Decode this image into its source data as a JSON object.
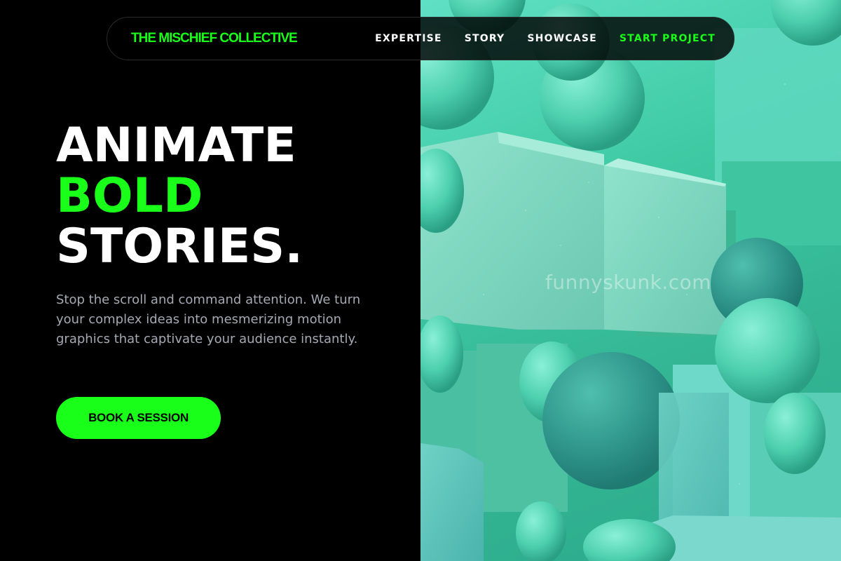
{
  "brand": {
    "name": "THE MISCHIEF COLLECTIVE"
  },
  "nav": {
    "items": [
      {
        "label": "EXPERTISE"
      },
      {
        "label": "STORY"
      },
      {
        "label": "SHOWCASE"
      },
      {
        "label": "START PROJECT"
      }
    ]
  },
  "hero": {
    "line1": "ANIMATE",
    "line2": "BOLD",
    "line3": "STORIES.",
    "description": "Stop the scroll and command attention. We turn your complex ideas into mesmerizing motion graphics that captivate your audience instantly.",
    "cta_label": "BOOK A SESSION"
  },
  "visual": {
    "watermark": "funnyskunk.com",
    "icon": "abstract-3d-shapes-illustration"
  },
  "colors": {
    "accent": "#1aff1a",
    "background": "#000000",
    "body_text": "#a4a9b3",
    "mint": "#4fd6b4"
  }
}
